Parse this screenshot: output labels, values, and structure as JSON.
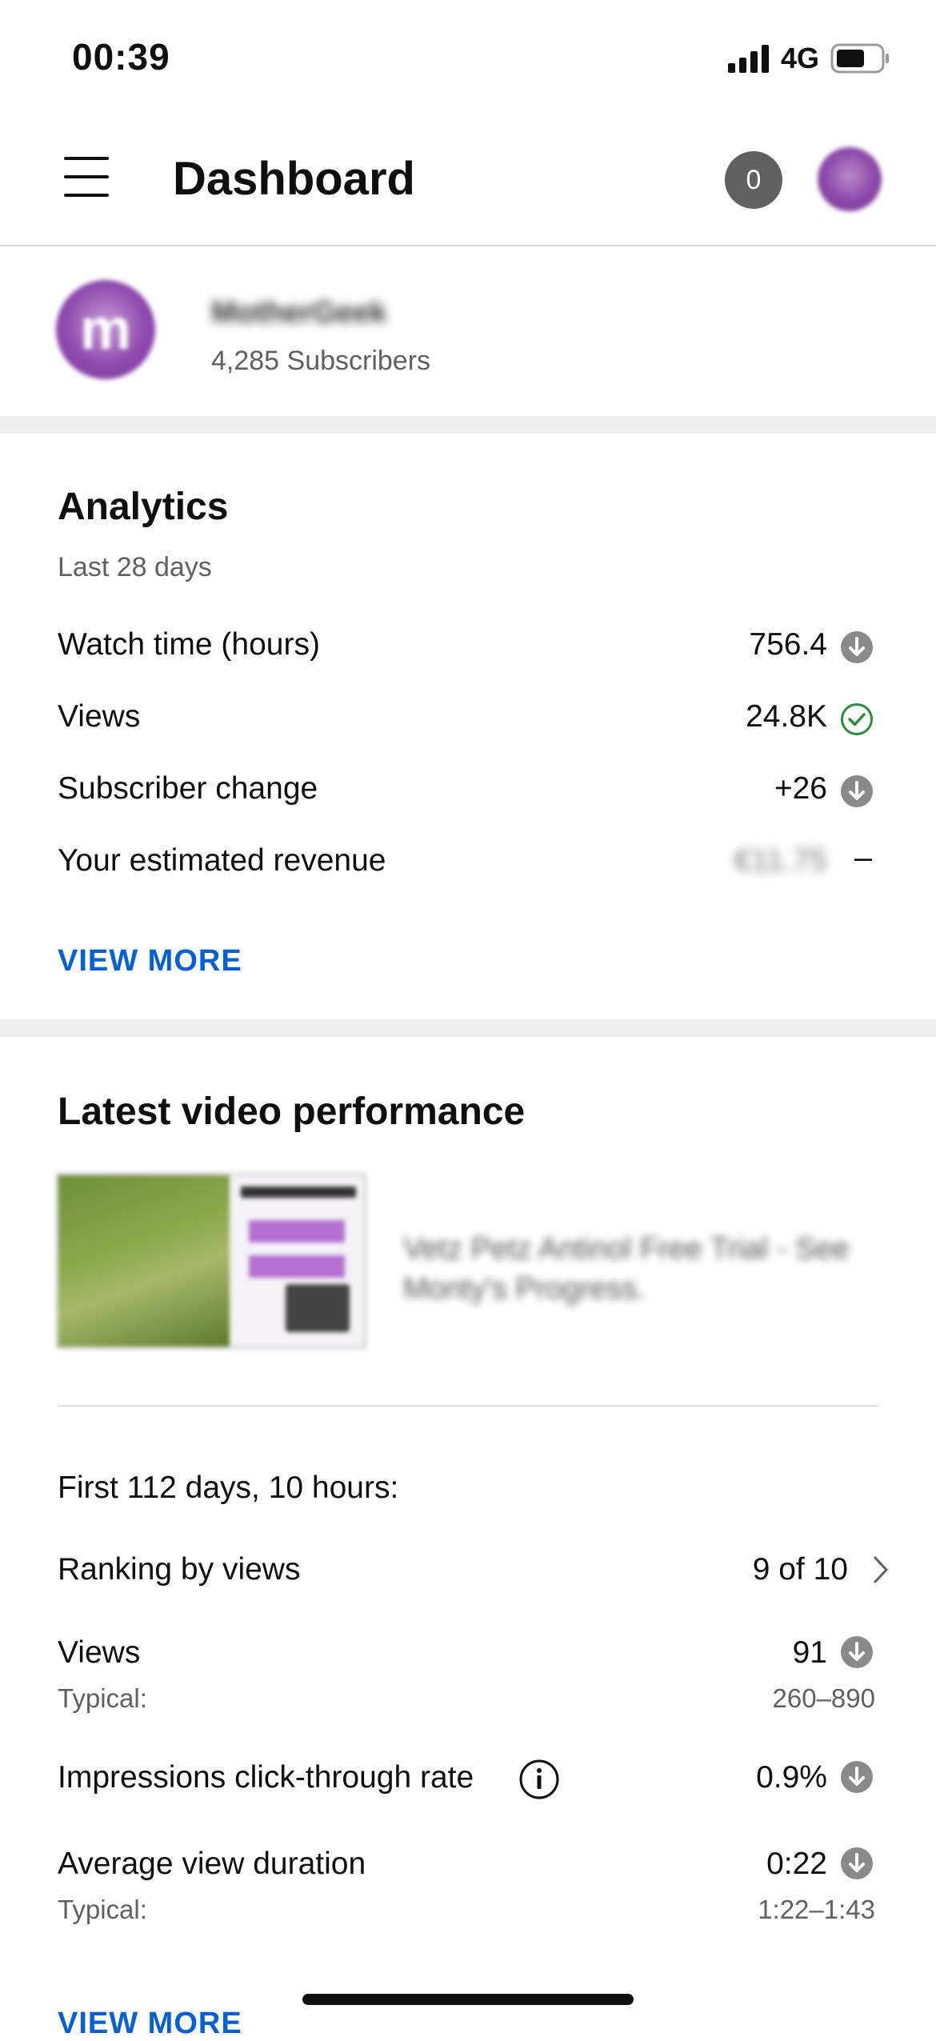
{
  "status_bar": {
    "time": "00:39",
    "network": "4G"
  },
  "app_bar": {
    "title": "Dashboard",
    "notification_count": "0"
  },
  "channel": {
    "name": "MotherGeek",
    "subscribers": "4,285 Subscribers",
    "avatar_letter": "m"
  },
  "analytics": {
    "title": "Analytics",
    "period": "Last 28 days",
    "rows": [
      {
        "label": "Watch time (hours)",
        "value": "756.4",
        "status": "down"
      },
      {
        "label": "Views",
        "value": "24.8K",
        "status": "ok"
      },
      {
        "label": "Subscriber change",
        "value": "+26",
        "status": "down"
      },
      {
        "label": "Your estimated revenue",
        "value": "€11.75",
        "status": "none",
        "status_text": "–"
      }
    ],
    "view_more": "VIEW MORE"
  },
  "latest_video": {
    "title": "Latest video performance",
    "video_title": "Vetz Petz Antinol Free Trial - See Monty's Progress.",
    "period": "First 112 days, 10 hours:",
    "ranking_label": "Ranking by views",
    "ranking_value": "9 of 10",
    "views_label": "Views",
    "views_value": "91",
    "views_typical_label": "Typical:",
    "views_typical_value": "260–890",
    "ctr_label": "Impressions click-through rate",
    "ctr_value": "0.9%",
    "avd_label": "Average view duration",
    "avd_value": "0:22",
    "avd_typical_label": "Typical:",
    "avd_typical_value": "1:22–1:43",
    "view_more": "VIEW MORE"
  },
  "colors": {
    "link": "#065fd4",
    "ok": "#2e8b3e",
    "down_icon": "#8a8a8a",
    "divider": "#efefef"
  }
}
